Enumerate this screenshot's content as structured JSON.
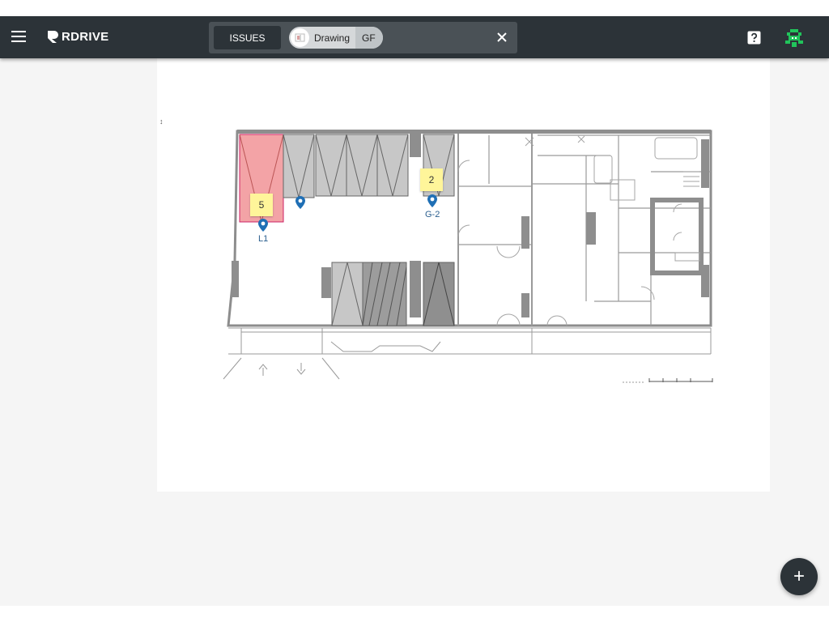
{
  "header": {
    "brand": "RDRIVE",
    "issues_label": "ISSUES",
    "drawing_label": "Drawing",
    "level_label": "GF",
    "colors": {
      "bar": "#2c3338",
      "accent_avatar": "#21c45b"
    }
  },
  "icons": {
    "menu": "hamburger-icon",
    "close": "close-icon",
    "help": "help-icon",
    "avatar": "pixel-avatar-icon",
    "add": "plus-icon"
  },
  "plan": {
    "markers": [
      {
        "count": "5",
        "label": "L1"
      },
      {
        "count": "2",
        "label": "G-2"
      }
    ],
    "highlight_color": "#f3a3a6",
    "note_color": "#fff59a",
    "pin_color": "#1f6fb5"
  },
  "fab": {
    "label": "+"
  }
}
